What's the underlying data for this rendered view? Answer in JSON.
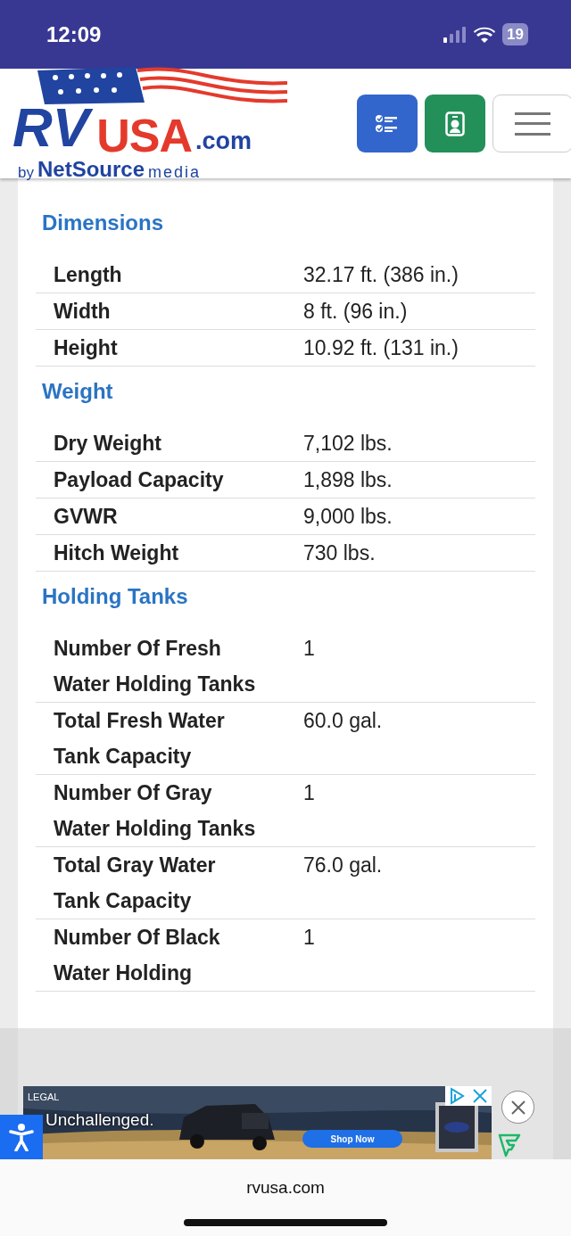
{
  "status_bar": {
    "time": "12:09",
    "battery": "19"
  },
  "header": {
    "logo": {
      "parts": [
        "RV",
        "USA",
        ".com"
      ],
      "tagline": [
        "by",
        "NetSource",
        "media"
      ]
    },
    "buttons": [
      {
        "kind": "checklist"
      },
      {
        "kind": "contact"
      },
      {
        "kind": "menu"
      }
    ]
  },
  "sections": [
    {
      "title": "Dimensions",
      "rows": [
        {
          "label": "Length",
          "value": "32.17 ft. (386 in.)"
        },
        {
          "label": "Width",
          "value": "8 ft. (96 in.)"
        },
        {
          "label": "Height",
          "value": "10.92 ft. (131 in.)"
        }
      ]
    },
    {
      "title": "Weight",
      "rows": [
        {
          "label": "Dry Weight",
          "value": "7,102 lbs."
        },
        {
          "label": "Payload Capacity",
          "value": "1,898 lbs."
        },
        {
          "label": "GVWR",
          "value": "9,000 lbs."
        },
        {
          "label": "Hitch Weight",
          "value": "730 lbs."
        }
      ]
    },
    {
      "title": "Holding Tanks",
      "rows": [
        {
          "label": "Number Of Fresh Water Holding Tanks",
          "value": "1"
        },
        {
          "label": "Total Fresh Water Tank Capacity",
          "value": "60.0 gal."
        },
        {
          "label": "Number Of Gray Water Holding Tanks",
          "value": "1"
        },
        {
          "label": "Total Gray Water Tank Capacity",
          "value": "76.0 gal."
        },
        {
          "label": "Number Of Black Water Holding",
          "value": "1"
        }
      ]
    }
  ],
  "ad": {
    "label": "LEGAL",
    "headline": "Unchallenged.",
    "cta": "Shop Now"
  },
  "browser_bar": {
    "url": "rvusa.com"
  }
}
